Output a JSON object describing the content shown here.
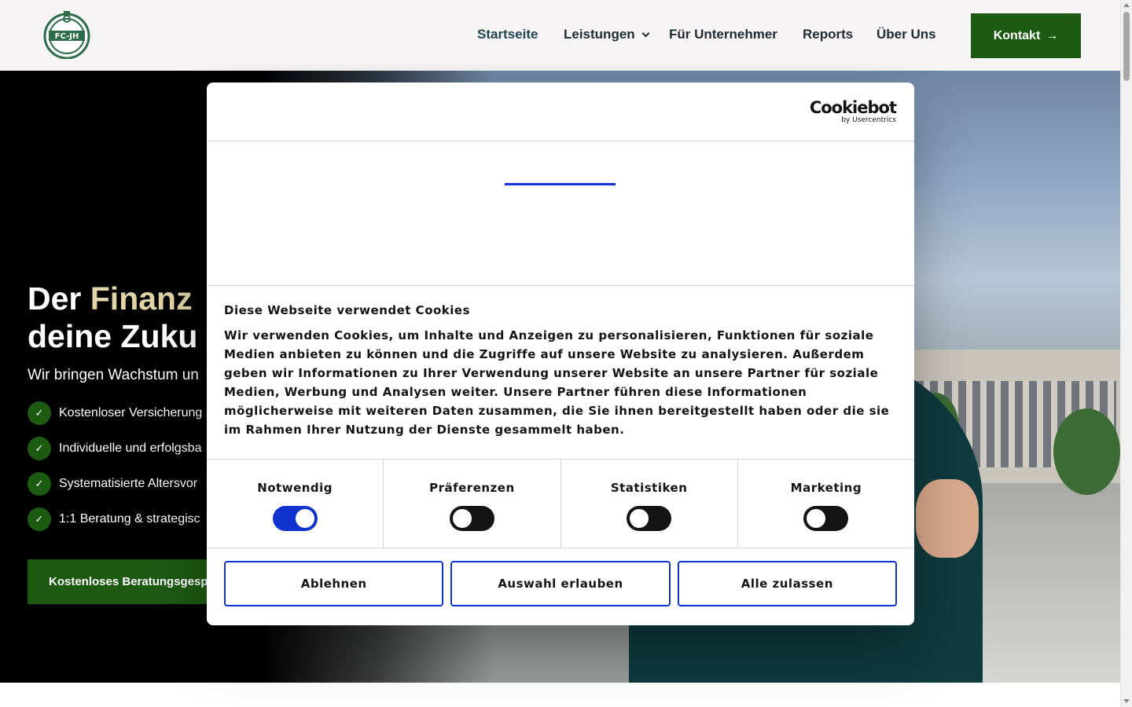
{
  "header": {
    "logo_text": "FC-JH",
    "nav": [
      {
        "label": "Startseite"
      },
      {
        "label": "Leistungen"
      },
      {
        "label": "Für Unternehmer"
      },
      {
        "label": "Reports"
      },
      {
        "label": "Über Uns"
      }
    ],
    "cta_label": "Kontakt"
  },
  "hero": {
    "title_line1_plain": "Der ",
    "title_line1_accent": "Finanz",
    "title_line2": "deine Zuku",
    "subtitle": "Wir bringen Wachstum un",
    "bullets": [
      {
        "text": "Kostenloser Versicherung"
      },
      {
        "text": "Individuelle und erfolgsba"
      },
      {
        "text": "Systematisierte Altersvor"
      },
      {
        "text": "1:1 Beratung & strategisc"
      }
    ],
    "cta_label": "Kostenloses Beratungsgesp"
  },
  "cookie_dialog": {
    "brand_main": "Cookiebot",
    "brand_sub": "by Usercentrics",
    "title": "Diese Webseite verwendet Cookies",
    "text": "Wir verwenden Cookies, um Inhalte und Anzeigen zu personalisieren, Funktionen für soziale Medien anbieten zu können und die Zugriffe auf unsere Website zu analysieren. Außerdem geben wir Informationen zu Ihrer Verwendung unserer Website an unsere Partner für soziale Medien, Werbung und Analysen weiter. Unsere Partner führen diese Informationen möglicherweise mit weiteren Daten zusammen, die Sie ihnen bereitgestellt haben oder die sie im Rahmen Ihrer Nutzung der Dienste gesammelt haben.",
    "categories": [
      {
        "label": "Notwendig",
        "enabled": true
      },
      {
        "label": "Präferenzen",
        "enabled": false
      },
      {
        "label": "Statistiken",
        "enabled": false
      },
      {
        "label": "Marketing",
        "enabled": false
      }
    ],
    "buttons": {
      "decline": "Ablehnen",
      "allow_selection": "Auswahl erlauben",
      "allow_all": "Alle zulassen"
    }
  },
  "colors": {
    "brand_green": "#1d5a12",
    "accent_gold": "#e1d4a8",
    "cookiebot_blue": "#1032cf"
  }
}
